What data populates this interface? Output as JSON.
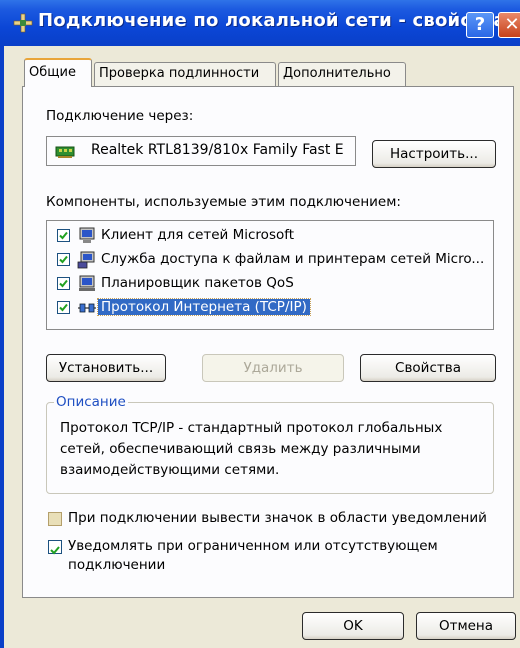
{
  "window": {
    "title": "Подключение по локальной сети - свойства",
    "help_label": "?",
    "close_label": "✕"
  },
  "tabs": [
    {
      "label": "Общие",
      "active": true
    },
    {
      "label": "Проверка подлинности",
      "active": false
    },
    {
      "label": "Дополнительно",
      "active": false
    }
  ],
  "general": {
    "connect_using_label": "Подключение через:",
    "adapter_name": "Realtek RTL8139/810x Family Fast E",
    "configure_label": "Настроить...",
    "components_label": "Компоненты, используемые этим подключением:",
    "components": [
      {
        "label": "Клиент для сетей Microsoft",
        "checked": true,
        "icon": "network-client-icon"
      },
      {
        "label": "Служба доступа к файлам и принтерам сетей Micro...",
        "checked": true,
        "icon": "file-printer-sharing-icon"
      },
      {
        "label": "Планировщик пакетов QoS",
        "checked": true,
        "icon": "qos-scheduler-icon"
      },
      {
        "label": "Протокол Интернета (TCP/IP)",
        "checked": true,
        "selected": true,
        "icon": "network-protocol-icon"
      }
    ],
    "install_label": "Установить...",
    "uninstall_label": "Удалить",
    "properties_label": "Свойства",
    "description_label": "Описание",
    "description_text": "Протокол TCP/IP - стандартный протокол глобальных сетей, обеспечивающий связь между различными взаимодействующими сетями.",
    "show_icon_label": "При подключении вывести значок в области уведомлений",
    "show_icon_checked": false,
    "notify_label": "Уведомлять при ограниченном или отсутствующем подключении",
    "notify_checked": true
  },
  "footer": {
    "ok_label": "OK",
    "cancel_label": "Отмена"
  },
  "colors": {
    "titlebar": "#0a46d6",
    "selection": "#316ac5",
    "dialog_face": "#ece9d8",
    "group_title": "#1f4fc2"
  }
}
